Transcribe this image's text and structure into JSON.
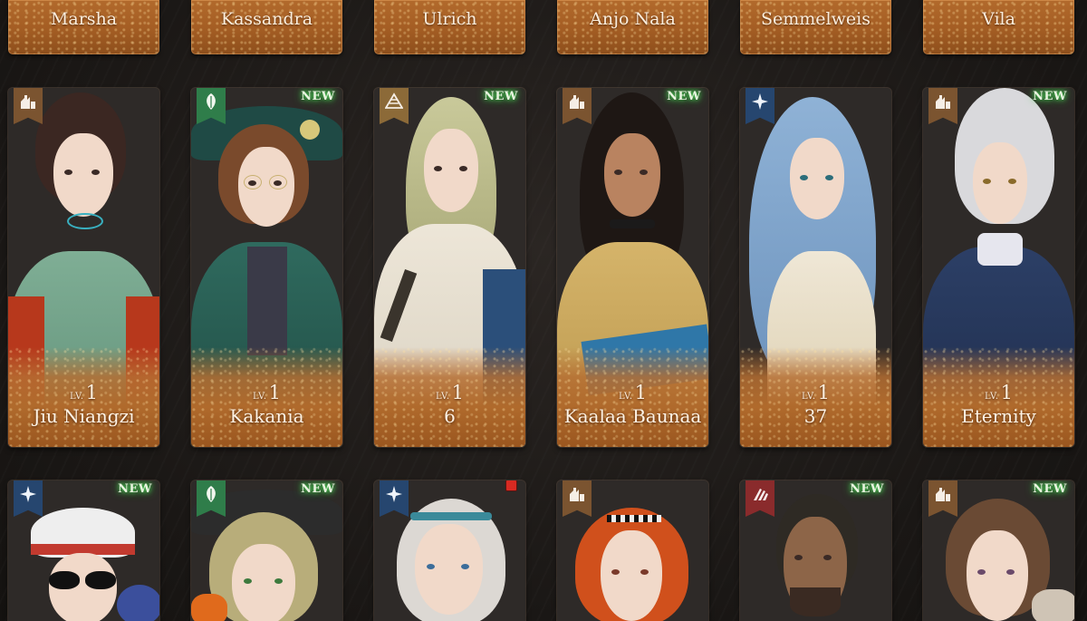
{
  "top_row": [
    {
      "name": "Marsha"
    },
    {
      "name": "Kassandra"
    },
    {
      "name": "Ulrich"
    },
    {
      "name": "Anjo Nala"
    },
    {
      "name": "Semmelweis"
    },
    {
      "name": "Vila"
    }
  ],
  "level_prefix": "LV.",
  "row1": [
    {
      "name": "Jiu Niangzi",
      "level": "1",
      "badge": "beast-afflatus-icon",
      "is_new": false
    },
    {
      "name": "Kakania",
      "level": "1",
      "badge": "plant-afflatus-icon",
      "is_new": true,
      "new_label": "NEW"
    },
    {
      "name": "6",
      "level": "1",
      "badge": "mineral-afflatus-icon",
      "is_new": true,
      "new_label": "NEW"
    },
    {
      "name": "Kaalaa Baunaa",
      "level": "1",
      "badge": "beast-afflatus-icon",
      "is_new": true,
      "new_label": "NEW"
    },
    {
      "name": "37",
      "level": "1",
      "badge": "star-afflatus-icon",
      "is_new": false
    },
    {
      "name": "Eternity",
      "level": "1",
      "badge": "beast-afflatus-icon",
      "is_new": true,
      "new_label": "NEW"
    }
  ],
  "row2": [
    {
      "badge": "star-afflatus-icon",
      "is_new": true,
      "new_label": "NEW"
    },
    {
      "badge": "plant-afflatus-icon",
      "is_new": true,
      "new_label": "NEW"
    },
    {
      "badge": "star-afflatus-icon",
      "is_new": false,
      "red_dot": true
    },
    {
      "badge": "beast-afflatus-icon",
      "is_new": false
    },
    {
      "badge": "spirit-afflatus-icon",
      "is_new": true,
      "new_label": "NEW"
    },
    {
      "badge": "beast-afflatus-icon",
      "is_new": true,
      "new_label": "NEW"
    }
  ],
  "colors": {
    "card_gold": "#b06a2c",
    "new_glow": "#5cff6a",
    "badge_beast": "#7b5430",
    "badge_plant": "#2f7d4a",
    "badge_mineral": "#8c6a38",
    "badge_star": "#26466f",
    "badge_spirit": "#8a2b2c"
  }
}
